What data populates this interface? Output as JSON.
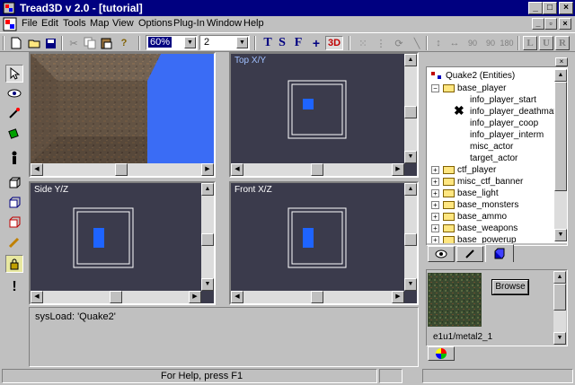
{
  "window": {
    "title": "Tread3D v 2.0 - [tutorial]"
  },
  "menu": [
    "File",
    "Edit",
    "Tools",
    "Map",
    "View",
    "Options",
    "Plug-In",
    "Window",
    "Help"
  ],
  "toolbar": {
    "zoom_value": "60%",
    "grid_value": "2",
    "mode_labels": [
      "T",
      "S",
      "F",
      "+",
      "3D"
    ],
    "snap_labels": [
      "90",
      "90",
      "180"
    ],
    "align_labels": [
      "L",
      "U",
      "R"
    ]
  },
  "viewports": {
    "camera_label": "",
    "top_label": "Top X/Y",
    "side_label": "Side Y/Z",
    "front_label": "Front X/Z"
  },
  "console": {
    "text": "sysLoad: 'Quake2'"
  },
  "entity_tree": {
    "root": "Quake2 (Entities)",
    "open_group": "base_player",
    "children": [
      "info_player_start",
      "info_player_deathmatch",
      "info_player_coop",
      "info_player_intermission_partial",
      "misc_actor",
      "target_actor"
    ],
    "children_display": [
      "info_player_start",
      "info_player_deathmatch",
      "info_player_coop",
      "info_player_interm",
      "misc_actor",
      "target_actor"
    ],
    "groups": [
      "ctf_player",
      "misc_ctf_banner",
      "base_light",
      "base_monsters",
      "base_ammo",
      "base_weapons",
      "base_powerup"
    ]
  },
  "texture_panel": {
    "browse_label": "Browse",
    "texture_name": "e1u1/metal2_1"
  },
  "status": {
    "text": "For Help, press F1"
  },
  "colors": {
    "titlebar": "#000080",
    "viewport_bg": "#3b3b4c",
    "brush_blue": "#1e64ff",
    "sky_blue": "#3a6cf5"
  }
}
